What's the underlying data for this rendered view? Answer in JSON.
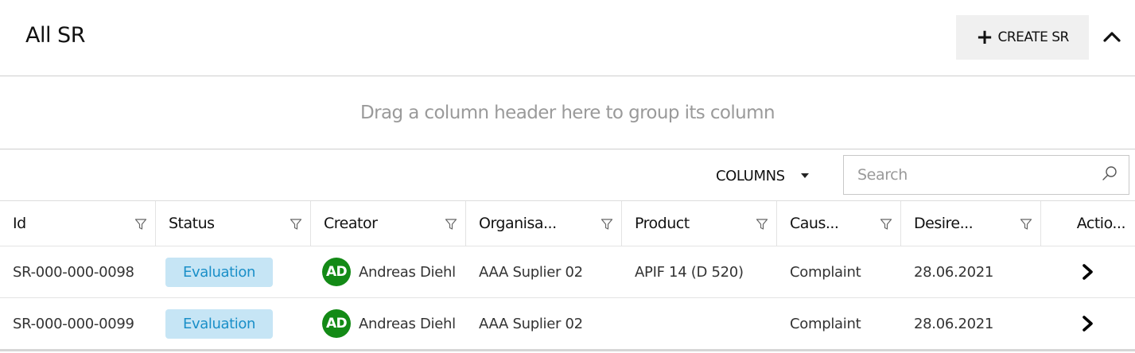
{
  "header": {
    "title": "All SR",
    "create_label": "CREATE SR"
  },
  "group_panel": {
    "text": "Drag a column header here to group its column"
  },
  "toolbar": {
    "columns_label": "COLUMNS",
    "search_placeholder": "Search",
    "search_value": ""
  },
  "table": {
    "columns": [
      "Id",
      "Status",
      "Creator",
      "Organisa...",
      "Product",
      "Caus...",
      "Desire...",
      "Actio..."
    ],
    "rows": [
      {
        "id": "SR-000-000-0098",
        "status": "Evaluation",
        "creator_initials": "AD",
        "creator": "Andreas Diehl",
        "organisation": "AAA Suplier 02",
        "product": "APIF 14 (D 520)",
        "cause": "Complaint",
        "desired": "28.06.2021"
      },
      {
        "id": "SR-000-000-0099",
        "status": "Evaluation",
        "creator_initials": "AD",
        "creator": "Andreas Diehl",
        "organisation": "AAA Suplier 02",
        "product": "",
        "cause": "Complaint",
        "desired": "28.06.2021"
      }
    ]
  },
  "colors": {
    "badge_bg": "#c6e5f5",
    "badge_text": "#1a8fc8",
    "avatar_bg": "#138a16",
    "button_bg": "#f0f0f0"
  },
  "icons": {
    "create": "plus-icon",
    "collapse": "chevron-up-icon",
    "columns_toggle": "caret-down-icon",
    "search": "search-icon",
    "column_filter": "filter-icon",
    "row_action": "chevron-right-icon"
  }
}
